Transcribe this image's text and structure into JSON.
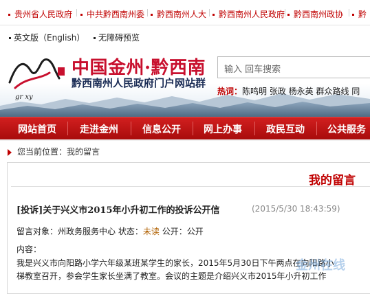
{
  "top_links": [
    "贵州省人民政府",
    "中共黔西南州委",
    "黔西南州人大",
    "黔西南州人民政府",
    "黔西南州政协",
    "黔"
  ],
  "lang_bar": {
    "english": "英文版（English）",
    "accessible": "无障碍预览"
  },
  "header": {
    "site_name": "中国金州·黔西南",
    "subtitle": "黔西南州人民政府门户网站群",
    "search_placeholder": "输入 回车搜索",
    "hot_label": "热词：",
    "hot_words": "陈鸣明 张政 杨永英 群众路线 同"
  },
  "nav": [
    "网站首页",
    "走进金州",
    "信息公开",
    "网上办事",
    "政民互动",
    "公共服务"
  ],
  "breadcrumb": "您当前位置：我的留言",
  "message_box": {
    "title": "我的留言",
    "msg_title": "[投诉]关于兴义市2015年小升初工作的投诉公开信",
    "msg_time": "(2015/5/30 18:43:59)",
    "target_label": "留言对象：",
    "target": "州政务服务中心",
    "status_label": "状态：",
    "status": "未读",
    "public_label": "公开：",
    "public": "公开",
    "content_label": "内容：",
    "body_line1": "我是兴义市向阳路小学六年级某班某学生的家长，2015年5月30日下午两点在向阳路小",
    "body_line2": "梯教室召开，参会学生家长坐满了教室。会议的主题是介绍兴义市2015年小升初工作"
  },
  "watermark": "金州在线",
  "colors": {
    "brand_red": "#c8102e",
    "nav_red": "#b81414",
    "navy": "#1a2c55"
  }
}
